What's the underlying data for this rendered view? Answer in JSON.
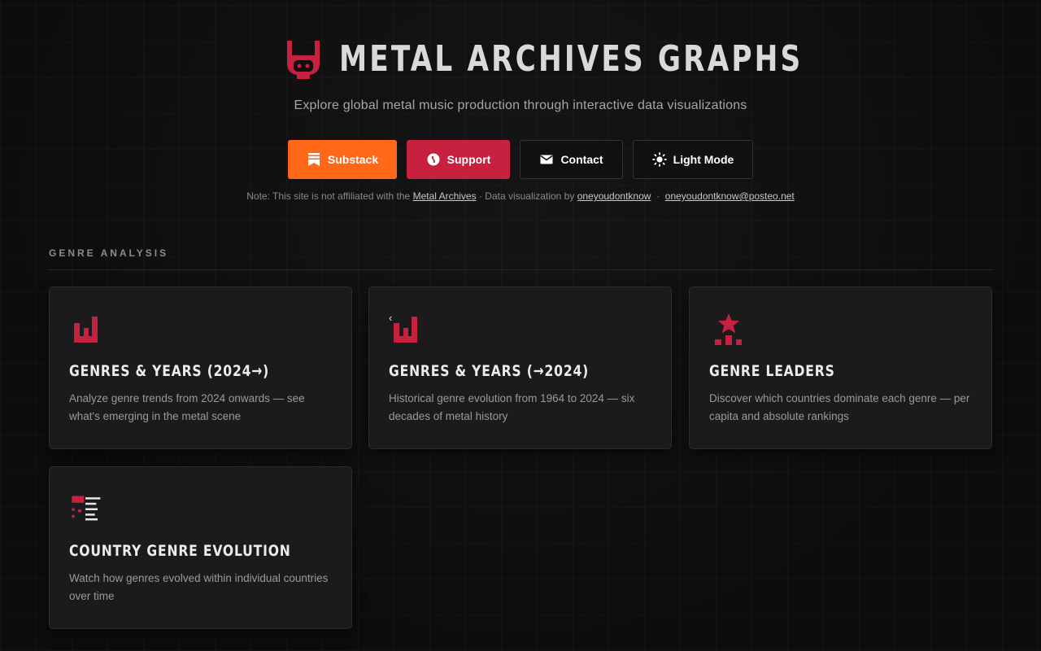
{
  "app": {
    "title": "METAL ARCHIVES GRAPHS",
    "subtitle": "Explore global metal music production through interactive data visualizations"
  },
  "buttons": {
    "substack": "Substack",
    "support": "Support",
    "contact": "Contact",
    "light_mode": "Light Mode"
  },
  "note": {
    "prefix": "Note: This site is not affiliated with the",
    "metal_archives_link": "Metal Archives",
    "middle": "· Data visualization by",
    "author_link": "oneyoudontknow",
    "separator": "·",
    "email_link": "oneyoudontknow@posteo.net"
  },
  "section": {
    "label": "GENRE ANALYSIS"
  },
  "cards": [
    {
      "title": "GENRES & YEARS (2024→)",
      "description": "Analyze genre trends from 2024 onwards — see what's emerging in the metal scene",
      "icon": "bar-chart-icon"
    },
    {
      "title": "GENRES & YEARS (→2024)",
      "description": "Historical genre evolution from 1964 to 2024 — six decades of metal history",
      "icon": "bar-chart-history-icon",
      "badge": "‹"
    },
    {
      "title": "GENRE LEADERS",
      "description": "Discover which countries dominate each genre — per capita and absolute rankings",
      "icon": "star-podium-icon"
    },
    {
      "title": "COUNTRY GENRE EVOLUTION",
      "description": "Watch how genres evolved within individual countries over time",
      "icon": "list-evolution-icon"
    }
  ],
  "colors": {
    "accent": "#c8203f",
    "substack": "#ff6719",
    "background": "#0f0f0f",
    "card": "#1b1b1b"
  }
}
